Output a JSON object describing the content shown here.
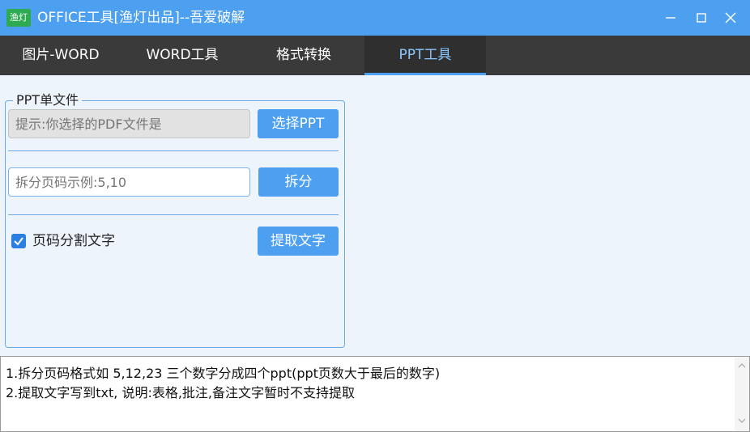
{
  "window": {
    "icon_text": "渔灯",
    "title": "OFFICE工具[渔灯出品]--吾爱破解"
  },
  "tabs": [
    {
      "label": "图片-WORD"
    },
    {
      "label": "WORD工具"
    },
    {
      "label": "格式转换"
    },
    {
      "label": "PPT工具"
    }
  ],
  "active_tab": "PPT工具",
  "group": {
    "title": "PPT单文件",
    "file_placeholder": "提示:你选择的PDF文件是",
    "select_button": "选择PPT",
    "split_placeholder": "拆分页码示例:5,10",
    "split_button": "拆分",
    "checkbox_label": "页码分割文字",
    "checkbox_checked": true,
    "extract_button": "提取文字"
  },
  "notes": {
    "line1": "1.拆分页码格式如 5,12,23 三个数字分成四个ppt(ppt页数大于最后的数字)",
    "line2": "2.提取文字写到txt, 说明:表格,批注,备注文字暂时不支持提取"
  },
  "colors": {
    "accent": "#4d9ff0",
    "tabbar": "#3a3a3a",
    "background": "#eef4fb"
  }
}
